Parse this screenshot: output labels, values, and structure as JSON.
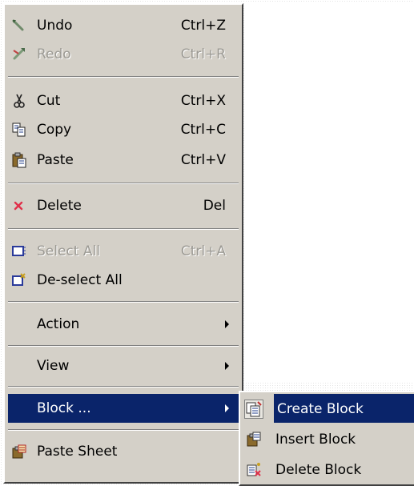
{
  "menu": {
    "items": [
      {
        "label": "Undo",
        "shortcut": "Ctrl+Z",
        "icon": "undo-icon",
        "enabled": true
      },
      {
        "label": "Redo",
        "shortcut": "Ctrl+R",
        "icon": "redo-icon",
        "enabled": false
      },
      {
        "label": "Cut",
        "shortcut": "Ctrl+X",
        "icon": "cut-icon",
        "enabled": true
      },
      {
        "label": "Copy",
        "shortcut": "Ctrl+C",
        "icon": "copy-icon",
        "enabled": true
      },
      {
        "label": "Paste",
        "shortcut": "Ctrl+V",
        "icon": "paste-icon",
        "enabled": true
      },
      {
        "label": "Delete",
        "shortcut": "Del",
        "icon": "delete-icon",
        "enabled": true
      },
      {
        "label": "Select All",
        "shortcut": "Ctrl+A",
        "icon": "select-all-icon",
        "enabled": false
      },
      {
        "label": "De-select All",
        "shortcut": "",
        "icon": "deselect-all-icon",
        "enabled": true
      },
      {
        "label": "Action",
        "submenu": true,
        "enabled": true
      },
      {
        "label": "View",
        "submenu": true,
        "enabled": true
      },
      {
        "label": "Block ...",
        "submenu": true,
        "enabled": true,
        "highlighted": true
      },
      {
        "label": "Paste Sheet",
        "icon": "paste-sheet-icon",
        "enabled": true
      }
    ]
  },
  "submenu": {
    "items": [
      {
        "label": "Create Block",
        "icon": "create-block-icon",
        "highlighted": true
      },
      {
        "label": "Insert Block",
        "icon": "insert-block-icon"
      },
      {
        "label": "Delete Block",
        "icon": "delete-block-icon"
      }
    ]
  },
  "colors": {
    "menu_bg": "#d4d0c8",
    "highlight": "#0a246a",
    "disabled_text": "#9c9a94"
  }
}
